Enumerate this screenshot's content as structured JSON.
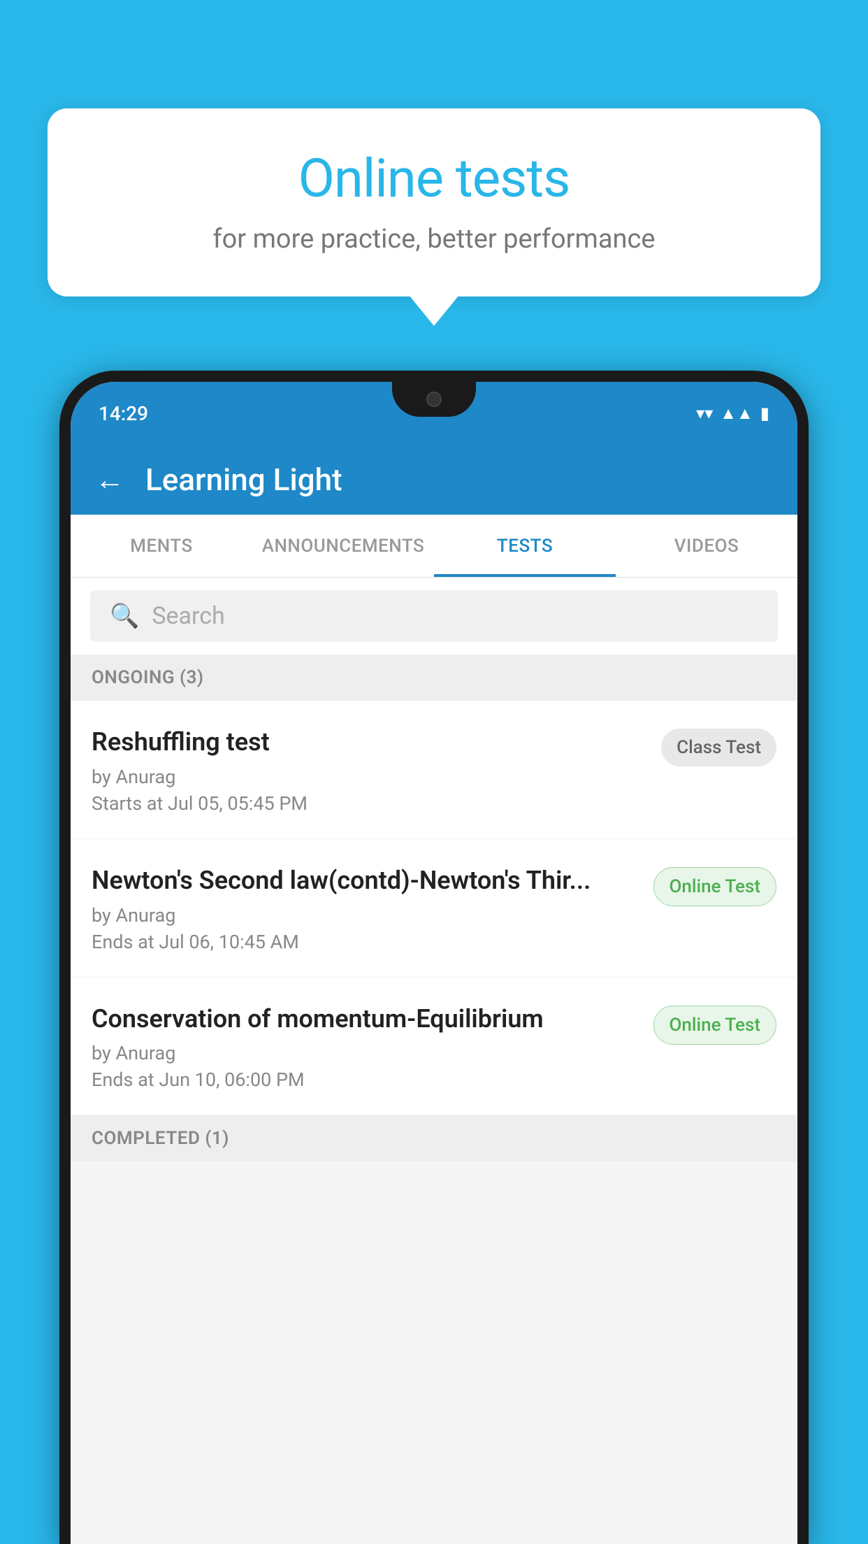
{
  "background_color": "#29b6e8",
  "speech_bubble": {
    "title": "Online tests",
    "subtitle": "for more practice, better performance"
  },
  "phone": {
    "status_bar": {
      "time": "14:29",
      "wifi_icon": "wifi",
      "signal_icon": "signal",
      "battery_icon": "battery"
    },
    "app_header": {
      "back_label": "←",
      "title": "Learning Light"
    },
    "tabs": [
      {
        "label": "MENTS",
        "active": false
      },
      {
        "label": "ANNOUNCEMENTS",
        "active": false
      },
      {
        "label": "TESTS",
        "active": true
      },
      {
        "label": "VIDEOS",
        "active": false
      }
    ],
    "search": {
      "placeholder": "Search"
    },
    "ongoing_section": {
      "label": "ONGOING (3)"
    },
    "test_items": [
      {
        "name": "Reshuffling test",
        "author": "by Anurag",
        "time_label": "Starts at  Jul 05, 05:45 PM",
        "badge": "Class Test",
        "badge_type": "class"
      },
      {
        "name": "Newton's Second law(contd)-Newton's Thir...",
        "author": "by Anurag",
        "time_label": "Ends at  Jul 06, 10:45 AM",
        "badge": "Online Test",
        "badge_type": "online"
      },
      {
        "name": "Conservation of momentum-Equilibrium",
        "author": "by Anurag",
        "time_label": "Ends at  Jun 10, 06:00 PM",
        "badge": "Online Test",
        "badge_type": "online"
      }
    ],
    "completed_section": {
      "label": "COMPLETED (1)"
    }
  }
}
